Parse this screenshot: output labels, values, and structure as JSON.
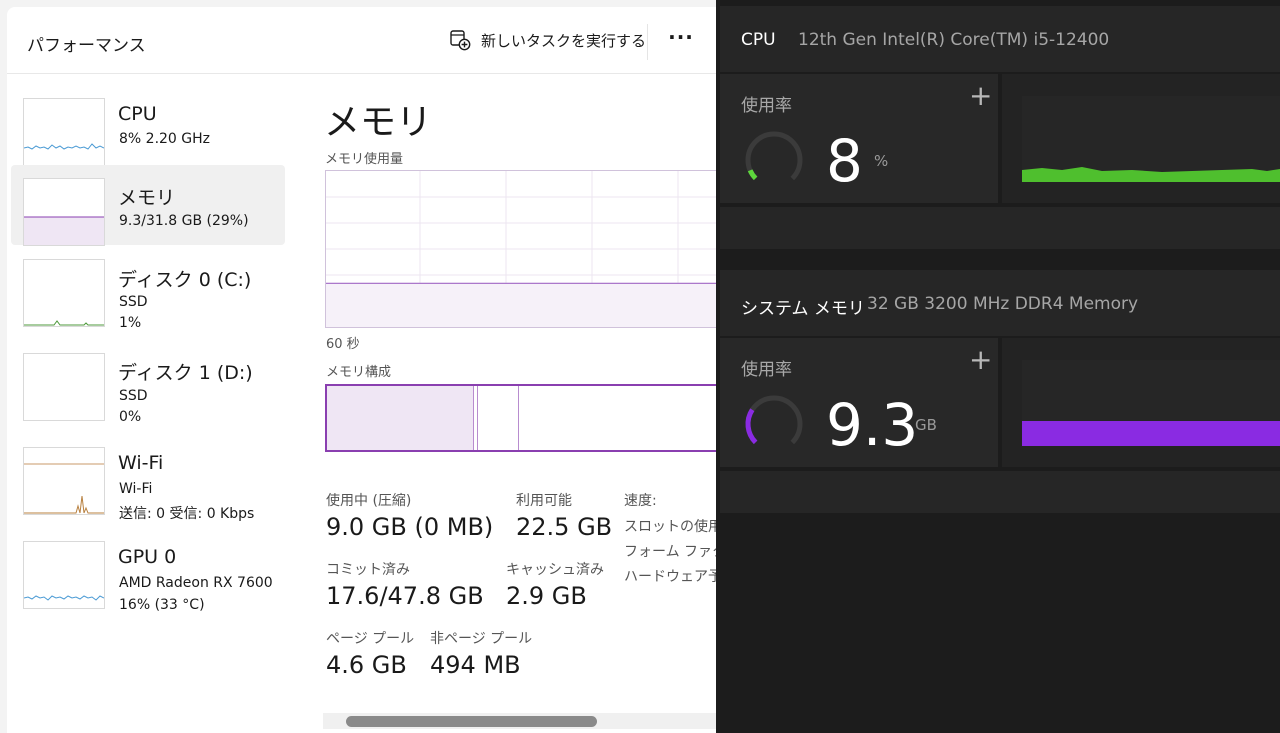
{
  "task_manager": {
    "header": {
      "title": "パフォーマンス",
      "run_task_label": "新しいタスクを実行する",
      "more_label": "···"
    },
    "sidebar": {
      "items": [
        {
          "name": "CPU",
          "line1": "8%  2.20 GHz",
          "line2": "",
          "line3": ""
        },
        {
          "name": "メモリ",
          "line1": "9.3/31.8 GB (29%)",
          "line2": "",
          "line3": ""
        },
        {
          "name": "ディスク 0 (C:)",
          "line1": "SSD",
          "line2": "1%",
          "line3": ""
        },
        {
          "name": "ディスク 1 (D:)",
          "line1": "SSD",
          "line2": "0%",
          "line3": ""
        },
        {
          "name": "Wi-Fi",
          "line1": "Wi-Fi",
          "line2": "送信: 0  受信: 0 Kbps",
          "line3": ""
        },
        {
          "name": "GPU 0",
          "line1": "AMD Radeon RX 7600",
          "line2": "16% (33 °C)",
          "line3": ""
        }
      ]
    },
    "main": {
      "title": "メモリ",
      "usage_label": "メモリ使用量",
      "time_label": "60 秒",
      "composition_label": "メモリ構成",
      "usage_level": 0.28,
      "stats": {
        "in_use_label": "使用中 (圧縮)",
        "in_use_value": "9.0 GB (0 MB)",
        "available_label": "利用可能",
        "available_value": "22.5 GB",
        "committed_label": "コミット済み",
        "committed_value": "17.6/47.8 GB",
        "cached_label": "キャッシュ済み",
        "cached_value": "2.9 GB",
        "paged_label": "ページ プール",
        "paged_value": "4.6 GB",
        "nonpaged_label": "非ページ プール",
        "nonpaged_value": "494 MB"
      },
      "specs": {
        "speed_label": "速度:",
        "slots_label": "スロットの使用",
        "form_label": "フォーム ファクタ",
        "hw_label": "ハードウェア予約"
      }
    }
  },
  "monitor": {
    "cpu": {
      "name": "CPU",
      "model": "12th Gen Intel(R) Core(TM) i5-12400",
      "usage_label": "使用率",
      "value": "8",
      "unit": "%",
      "gauge_fraction": 0.08,
      "color": "#5dd63c"
    },
    "memory": {
      "name": "システム メモリ",
      "model": "32 GB 3200 MHz DDR4 Memory",
      "usage_label": "使用率",
      "value": "9.3",
      "unit": "GB",
      "gauge_fraction": 0.29,
      "color": "#8a2be2"
    },
    "plus_label": "+"
  },
  "colors": {
    "accent_memory": "#8a3fb0",
    "accent_cpu_chart": "#4a9ad4"
  }
}
